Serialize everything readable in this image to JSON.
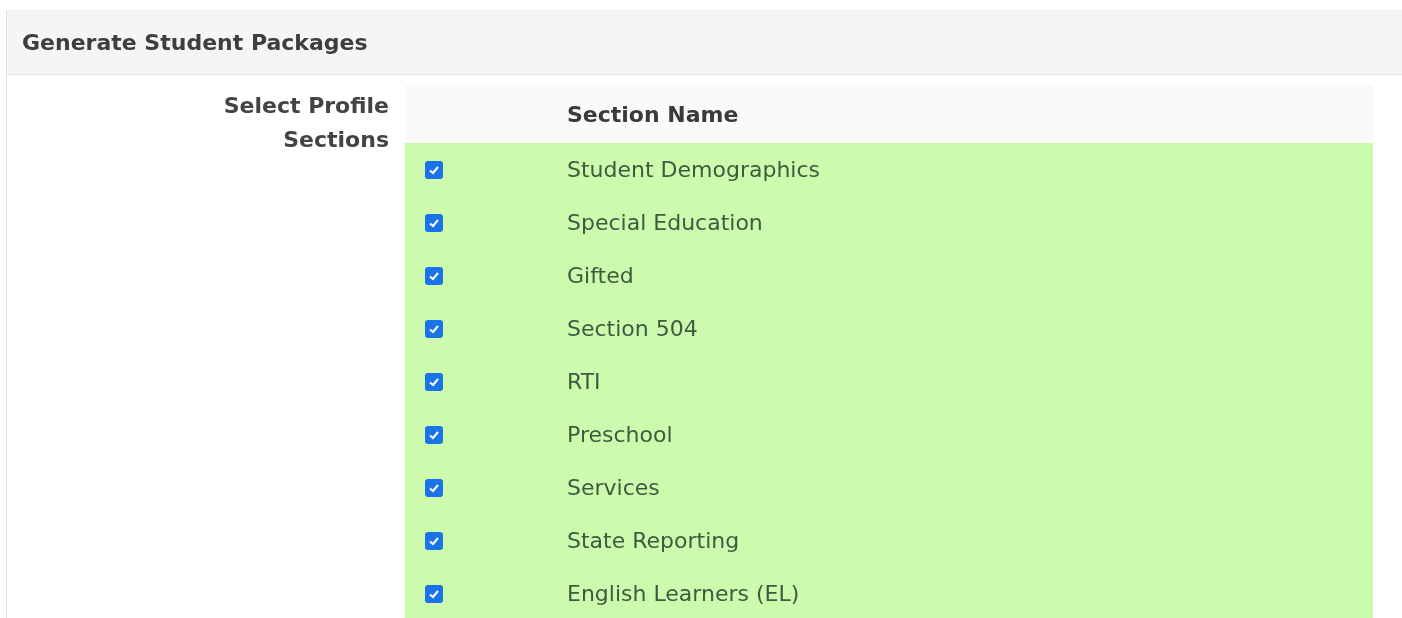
{
  "panel": {
    "title": "Generate Student Packages"
  },
  "field": {
    "label": "Select Profile Sections"
  },
  "table": {
    "columns": [
      "Section Name"
    ],
    "rows": [
      {
        "name": "Student Demographics",
        "checked": true
      },
      {
        "name": "Special Education",
        "checked": true
      },
      {
        "name": "Gifted",
        "checked": true
      },
      {
        "name": "Section 504",
        "checked": true
      },
      {
        "name": "RTI",
        "checked": true
      },
      {
        "name": "Preschool",
        "checked": true
      },
      {
        "name": "Services",
        "checked": true
      },
      {
        "name": "State Reporting",
        "checked": true
      },
      {
        "name": "English Learners (EL)",
        "checked": true
      }
    ]
  }
}
